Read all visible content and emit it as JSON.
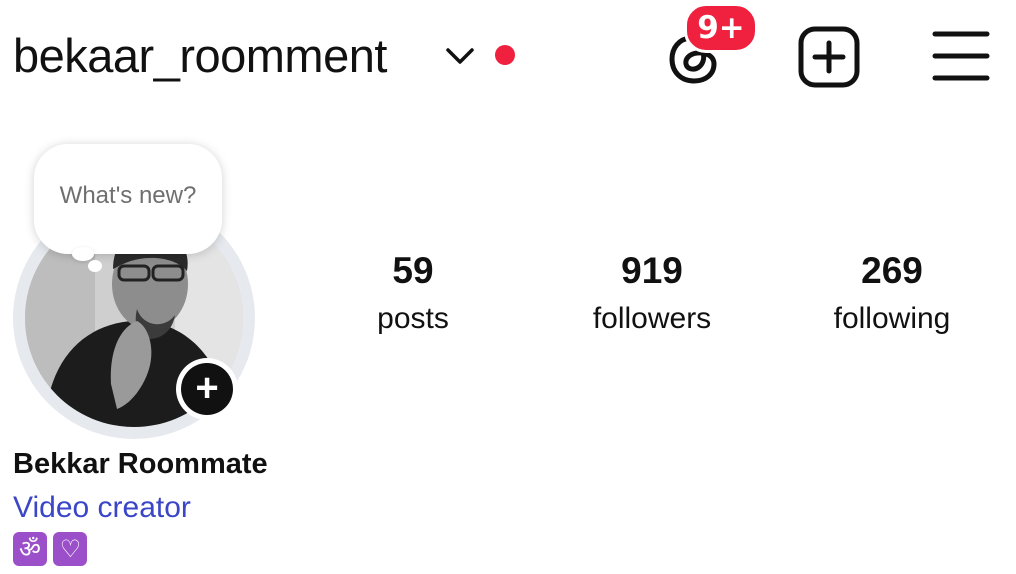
{
  "header": {
    "username": "bekaar_roomment",
    "notification_badge": "9+",
    "accent_color": "#f0213f"
  },
  "profile": {
    "note_bubble_placeholder": "What's new?",
    "stats": [
      {
        "value": "59",
        "label": "posts"
      },
      {
        "value": "919",
        "label": "followers"
      },
      {
        "value": "269",
        "label": "following"
      }
    ],
    "display_name": "Bekkar Roommate",
    "category": "Video creator",
    "bio_emojis": [
      "ॐ",
      "♡"
    ]
  },
  "icons": {
    "account_switch": "chevron-down-icon",
    "threads": "threads-icon",
    "create": "plus-square-icon",
    "menu": "hamburger-menu-icon",
    "add_story": "plus-icon"
  }
}
